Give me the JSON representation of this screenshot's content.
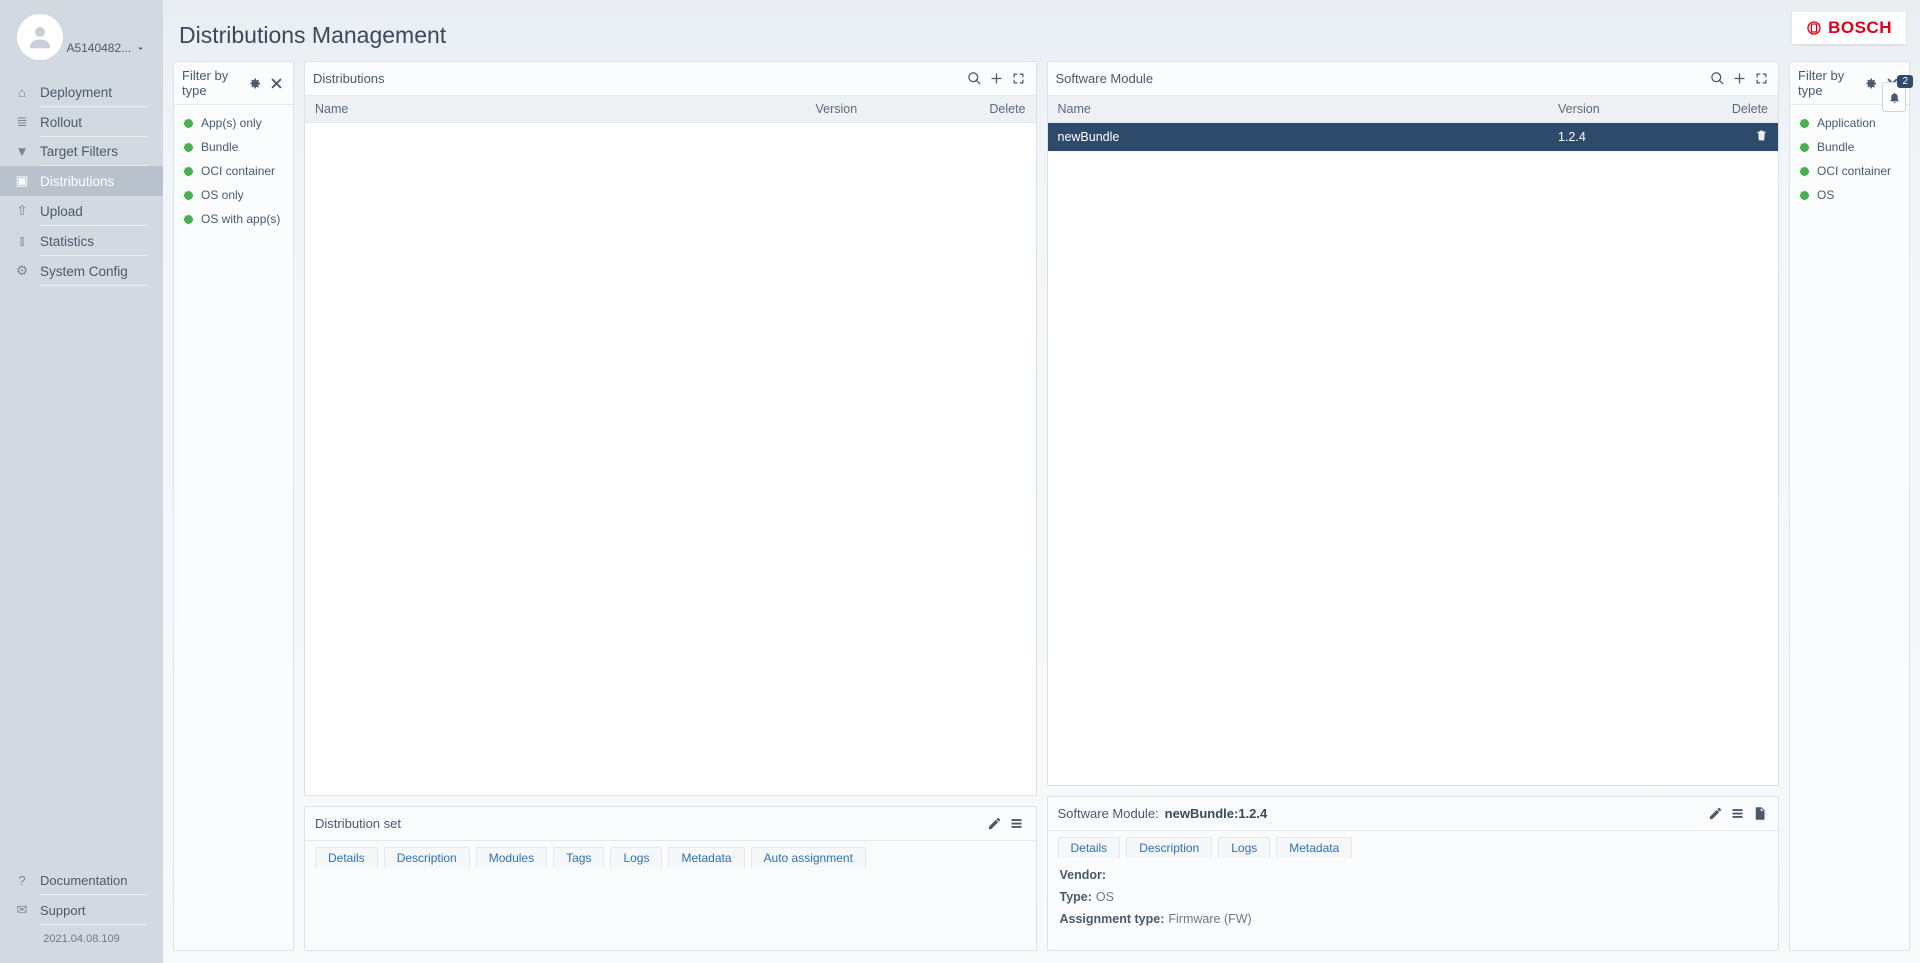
{
  "page": {
    "title": "Distributions Management"
  },
  "user": {
    "name": "A5140482..."
  },
  "brand": "BOSCH",
  "notifications": {
    "count": "2"
  },
  "version": "2021.04.08.109",
  "nav": {
    "items": [
      {
        "label": "Deployment"
      },
      {
        "label": "Rollout"
      },
      {
        "label": "Target Filters"
      },
      {
        "label": "Distributions"
      },
      {
        "label": "Upload"
      },
      {
        "label": "Statistics"
      },
      {
        "label": "System Config"
      }
    ],
    "bottom": [
      {
        "label": "Documentation"
      },
      {
        "label": "Support"
      }
    ]
  },
  "left_filter": {
    "title": "Filter by type",
    "items": [
      {
        "label": "App(s) only"
      },
      {
        "label": "Bundle"
      },
      {
        "label": "OCI container"
      },
      {
        "label": "OS only"
      },
      {
        "label": "OS with app(s)"
      }
    ]
  },
  "right_filter": {
    "title": "Filter by type",
    "items": [
      {
        "label": "Application"
      },
      {
        "label": "Bundle"
      },
      {
        "label": "OCI container"
      },
      {
        "label": "OS"
      }
    ]
  },
  "distributions_panel": {
    "title": "Distributions",
    "columns": {
      "name": "Name",
      "version": "Version",
      "delete": "Delete"
    },
    "rows": []
  },
  "softmod_panel": {
    "title": "Software Module",
    "columns": {
      "name": "Name",
      "version": "Version",
      "delete": "Delete"
    },
    "rows": [
      {
        "name": "newBundle",
        "version": "1.2.4",
        "selected": true
      }
    ]
  },
  "dist_detail": {
    "title": "Distribution set",
    "tabs": [
      "Details",
      "Description",
      "Modules",
      "Tags",
      "Logs",
      "Metadata",
      "Auto assignment"
    ]
  },
  "sm_detail": {
    "title_prefix": "Software Module:",
    "title_value": "newBundle:1.2.4",
    "tabs": [
      "Details",
      "Description",
      "Logs",
      "Metadata"
    ],
    "fields": {
      "vendor_k": "Vendor:",
      "vendor_v": "",
      "type_k": "Type:",
      "type_v": "OS",
      "assign_k": "Assignment type:",
      "assign_v": "Firmware (FW)"
    }
  }
}
